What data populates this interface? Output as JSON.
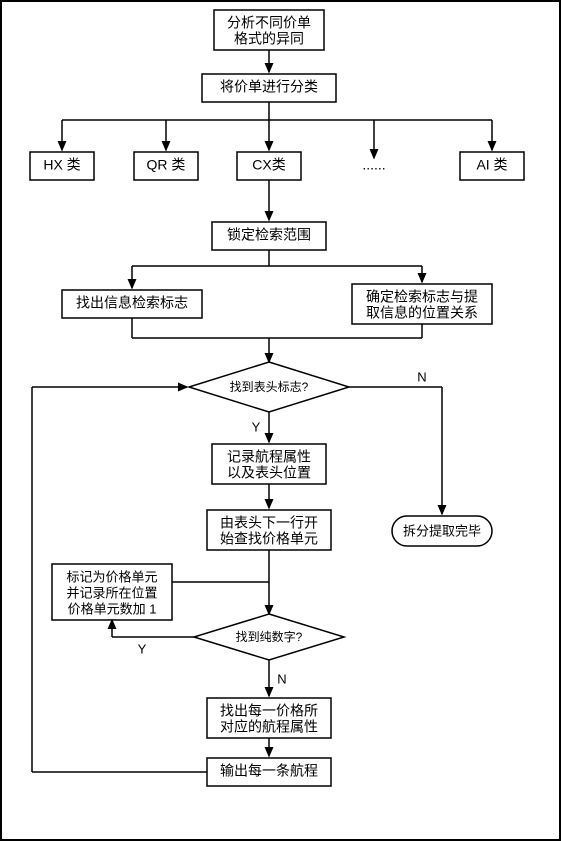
{
  "chart_data": {
    "type": "flowchart",
    "title": "",
    "nodes": [
      {
        "id": "n1",
        "type": "process",
        "text": "分析不同价单\n格式的异同"
      },
      {
        "id": "n2",
        "type": "process",
        "text": "将价单进行分类"
      },
      {
        "id": "c1",
        "type": "process",
        "text": "HX 类"
      },
      {
        "id": "c2",
        "type": "process",
        "text": "QR 类"
      },
      {
        "id": "c3",
        "type": "process",
        "text": "CX类"
      },
      {
        "id": "c4",
        "type": "ellipsis",
        "text": "......"
      },
      {
        "id": "c5",
        "type": "process",
        "text": "AI 类"
      },
      {
        "id": "n3",
        "type": "process",
        "text": "锁定检索范围"
      },
      {
        "id": "n4",
        "type": "process",
        "text": "找出信息检索标志"
      },
      {
        "id": "n5",
        "type": "process",
        "text": "确定检索标志与提\n取信息的位置关系"
      },
      {
        "id": "d1",
        "type": "decision",
        "text": "找到表头标志?"
      },
      {
        "id": "n6",
        "type": "process",
        "text": "记录航程属性\n以及表头位置"
      },
      {
        "id": "n7",
        "type": "process",
        "text": "由表头下一行开\n始查找价格单元"
      },
      {
        "id": "t1",
        "type": "terminator",
        "text": "拆分提取完毕"
      },
      {
        "id": "n8",
        "type": "process",
        "text": "标记为价格单元\n并记录所在位置\n价格单元数加 1"
      },
      {
        "id": "d2",
        "type": "decision",
        "text": "找到纯数字?"
      },
      {
        "id": "n9",
        "type": "process",
        "text": "找出每一价格所\n对应的航程属性"
      },
      {
        "id": "n10",
        "type": "process",
        "text": "输出每一条航程"
      }
    ],
    "edges": [
      {
        "from": "n1",
        "to": "n2"
      },
      {
        "from": "n2",
        "to": "c1"
      },
      {
        "from": "n2",
        "to": "c2"
      },
      {
        "from": "n2",
        "to": "c3"
      },
      {
        "from": "n2",
        "to": "c4"
      },
      {
        "from": "n2",
        "to": "c5"
      },
      {
        "from": "c3",
        "to": "n3"
      },
      {
        "from": "n3",
        "to": "n4"
      },
      {
        "from": "n3",
        "to": "n5"
      },
      {
        "from": "n4",
        "to": "d1"
      },
      {
        "from": "n5",
        "to": "d1"
      },
      {
        "from": "d1",
        "to": "n6",
        "label": "Y"
      },
      {
        "from": "d1",
        "to": "t1",
        "label": "N"
      },
      {
        "from": "n6",
        "to": "n7"
      },
      {
        "from": "n7",
        "to": "d2"
      },
      {
        "from": "d2",
        "to": "n8",
        "label": "Y"
      },
      {
        "from": "n8",
        "to": "d2"
      },
      {
        "from": "d2",
        "to": "n9",
        "label": "N"
      },
      {
        "from": "n9",
        "to": "n10"
      },
      {
        "from": "n10",
        "to": "d1"
      }
    ]
  },
  "labels": {
    "n1a": "分析不同价单",
    "n1b": "格式的异同",
    "n2": "将价单进行分类",
    "c1": "HX 类",
    "c2": "QR 类",
    "c3": "CX类",
    "c4": "......",
    "c5": "AI 类",
    "n3": "锁定检索范围",
    "n4": "找出信息检索标志",
    "n5a": "确定检索标志与提",
    "n5b": "取信息的位置关系",
    "d1": "找到表头标志?",
    "n6a": "记录航程属性",
    "n6b": "以及表头位置",
    "n7a": "由表头下一行开",
    "n7b": "始查找价格单元",
    "t1": "拆分提取完毕",
    "n8a": "标记为价格单元",
    "n8b": "并记录所在位置",
    "n8c": "价格单元数加 1",
    "d2": "找到纯数字?",
    "n9a": "找出每一价格所",
    "n9b": "对应的航程属性",
    "n10": "输出每一条航程",
    "Y": "Y",
    "N": "N"
  }
}
